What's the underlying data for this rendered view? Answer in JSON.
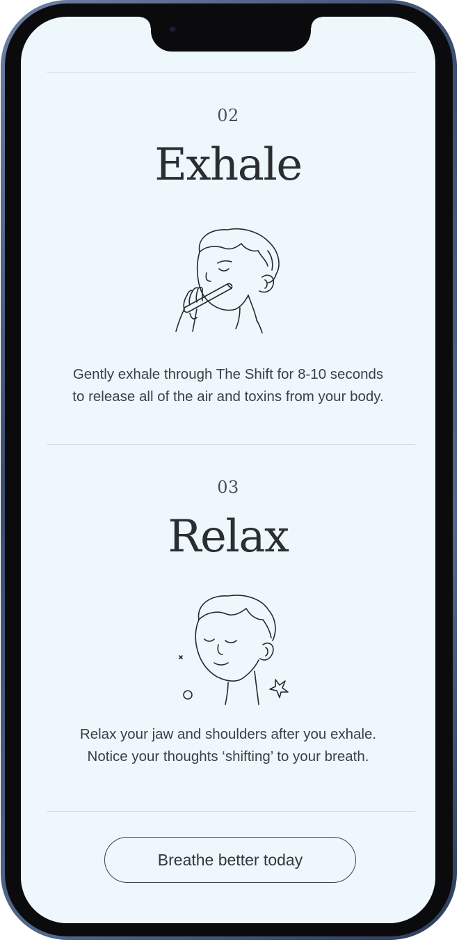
{
  "steps": [
    {
      "number": "02",
      "title": "Exhale",
      "illustration": "person-exhaling-through-tube-icon",
      "description_line1": "Gently exhale through The Shift for 8-10 seconds",
      "description_line2": "to release all of the air and toxins from your body."
    },
    {
      "number": "03",
      "title": "Relax",
      "illustration": "person-relaxing-eyes-closed-icon",
      "description_line1": "Relax your jaw and shoulders after you exhale.",
      "description_line2": "Notice your thoughts ‘shifting’ to your breath."
    }
  ],
  "cta": {
    "label": "Breathe better today"
  },
  "colors": {
    "screen_background": "#eef7fc",
    "text": "#2a2d31",
    "divider": "#d7dee3",
    "phone_frame": "#3c4d6e"
  }
}
